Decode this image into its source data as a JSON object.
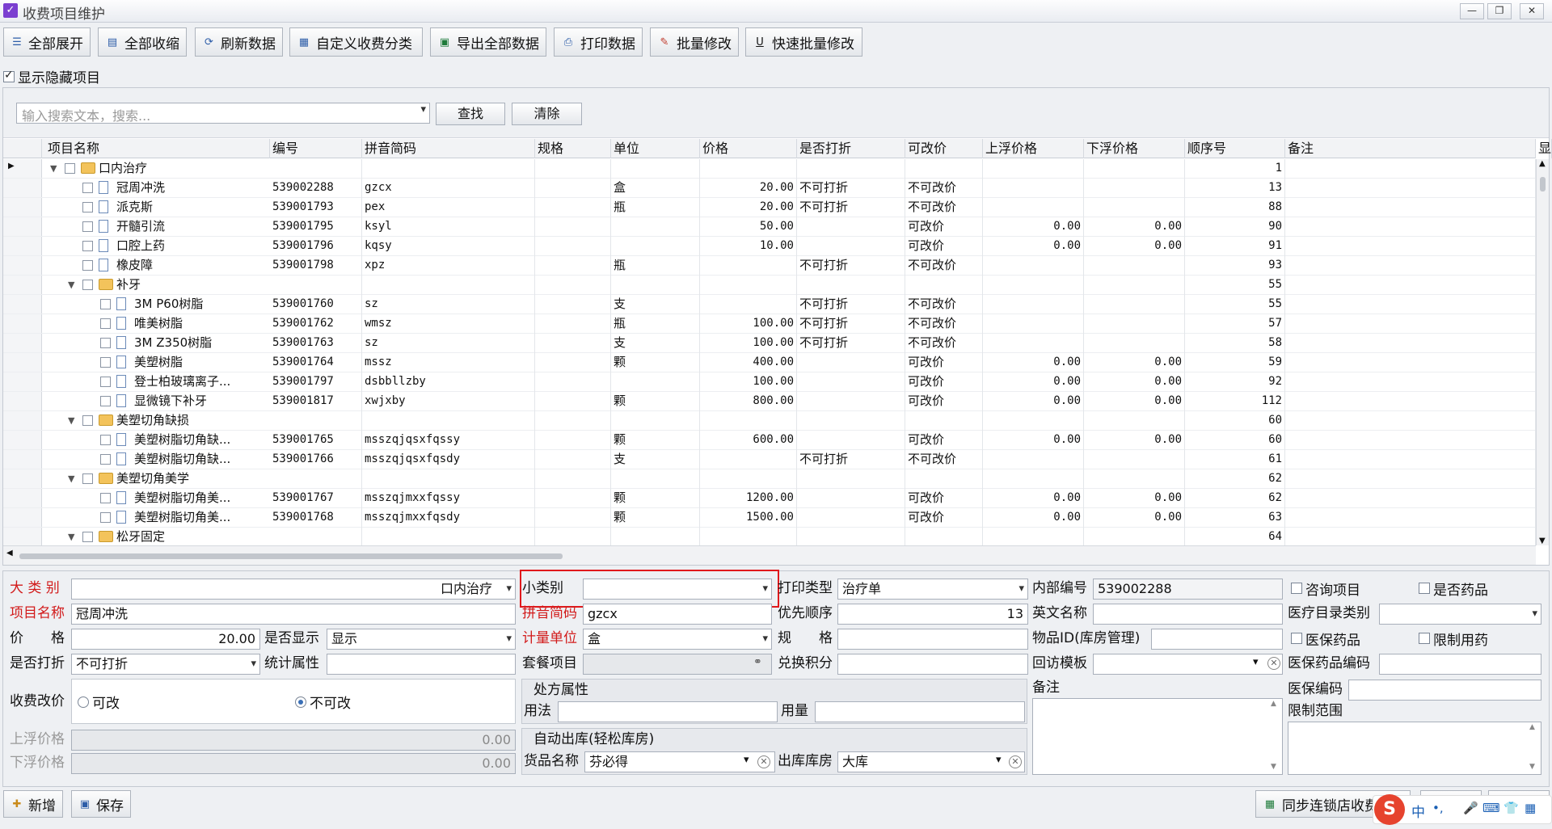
{
  "window": {
    "title": "收费项目维护",
    "controls": {
      "minimize": "—",
      "restore": "❐",
      "close": "✕"
    }
  },
  "toolbar": {
    "buttons": [
      {
        "label": "全部展开",
        "icon": "expand-list-icon"
      },
      {
        "label": "全部收缩",
        "icon": "collapse-list-icon"
      },
      {
        "label": "刷新数据",
        "icon": "refresh-icon"
      },
      {
        "label": "自定义收费分类",
        "icon": "category-edit-icon"
      },
      {
        "label": "导出全部数据",
        "icon": "excel-export-icon"
      },
      {
        "label": "打印数据",
        "icon": "printer-icon"
      },
      {
        "label": "批量修改",
        "icon": "batch-edit-icon"
      },
      {
        "label": "快速批量修改",
        "icon": "underline-u-icon"
      }
    ],
    "show_hidden_label": "显示隐藏项目",
    "show_hidden_checked": true
  },
  "search": {
    "placeholder": "输入搜索文本，搜索...",
    "find_label": "查找",
    "clear_label": "清除"
  },
  "grid": {
    "columns": [
      "项目名称",
      "编号",
      "拼音简码",
      "规格",
      "单位",
      "价格",
      "是否打折",
      "可改价",
      "上浮价格",
      "下浮价格",
      "顺序号",
      "备注",
      "显"
    ],
    "rows": [
      {
        "name": "口内治疗",
        "code": "",
        "py": "",
        "spec": "",
        "unit": "",
        "price": "",
        "discount": "",
        "editable": "",
        "up": "",
        "down": "",
        "order": "1",
        "level": 0,
        "type": "folder",
        "open": true
      },
      {
        "name": "冠周冲洗",
        "code": "539002288",
        "py": "gzcx",
        "spec": "",
        "unit": "盒",
        "price": "20.00",
        "discount": "不可打折",
        "editable": "不可改价",
        "up": "",
        "down": "",
        "order": "13",
        "level": 1,
        "type": "item"
      },
      {
        "name": "派克斯",
        "code": "539001793",
        "py": "pex",
        "spec": "",
        "unit": "瓶",
        "price": "20.00",
        "discount": "不可打折",
        "editable": "不可改价",
        "up": "",
        "down": "",
        "order": "88",
        "level": 1,
        "type": "item"
      },
      {
        "name": "开髓引流",
        "code": "539001795",
        "py": "ksyl",
        "spec": "",
        "unit": "",
        "price": "50.00",
        "discount": "",
        "editable": "可改价",
        "up": "0.00",
        "down": "0.00",
        "order": "90",
        "level": 1,
        "type": "item"
      },
      {
        "name": "口腔上药",
        "code": "539001796",
        "py": "kqsy",
        "spec": "",
        "unit": "",
        "price": "10.00",
        "discount": "",
        "editable": "可改价",
        "up": "0.00",
        "down": "0.00",
        "order": "91",
        "level": 1,
        "type": "item"
      },
      {
        "name": "橡皮障",
        "code": "539001798",
        "py": "xpz",
        "spec": "",
        "unit": "瓶",
        "price": "",
        "discount": "不可打折",
        "editable": "不可改价",
        "up": "",
        "down": "",
        "order": "93",
        "level": 1,
        "type": "item"
      },
      {
        "name": "补牙",
        "code": "",
        "py": "",
        "spec": "",
        "unit": "",
        "price": "",
        "discount": "",
        "editable": "",
        "up": "",
        "down": "",
        "order": "55",
        "level": 1,
        "type": "folder",
        "open": true
      },
      {
        "name": "3M P60树脂",
        "code": "539001760",
        "py": "sz",
        "spec": "",
        "unit": "支",
        "price": "",
        "discount": "不可打折",
        "editable": "不可改价",
        "up": "",
        "down": "",
        "order": "55",
        "level": 2,
        "type": "item"
      },
      {
        "name": "唯美树脂",
        "code": "539001762",
        "py": "wmsz",
        "spec": "",
        "unit": "瓶",
        "price": "100.00",
        "discount": "不可打折",
        "editable": "不可改价",
        "up": "",
        "down": "",
        "order": "57",
        "level": 2,
        "type": "item"
      },
      {
        "name": "3M Z350树脂",
        "code": "539001763",
        "py": "sz",
        "spec": "",
        "unit": "支",
        "price": "100.00",
        "discount": "不可打折",
        "editable": "不可改价",
        "up": "",
        "down": "",
        "order": "58",
        "level": 2,
        "type": "item"
      },
      {
        "name": "美塑树脂",
        "code": "539001764",
        "py": "mssz",
        "spec": "",
        "unit": "颗",
        "price": "400.00",
        "discount": "",
        "editable": "可改价",
        "up": "0.00",
        "down": "0.00",
        "order": "59",
        "level": 2,
        "type": "item"
      },
      {
        "name": "登士柏玻璃离子...",
        "code": "539001797",
        "py": "dsbbllzby",
        "spec": "",
        "unit": "",
        "price": "100.00",
        "discount": "",
        "editable": "可改价",
        "up": "0.00",
        "down": "0.00",
        "order": "92",
        "level": 2,
        "type": "item"
      },
      {
        "name": "显微镜下补牙",
        "code": "539001817",
        "py": "xwjxby",
        "spec": "",
        "unit": "颗",
        "price": "800.00",
        "discount": "",
        "editable": "可改价",
        "up": "0.00",
        "down": "0.00",
        "order": "112",
        "level": 2,
        "type": "item"
      },
      {
        "name": "美塑切角缺损",
        "code": "",
        "py": "",
        "spec": "",
        "unit": "",
        "price": "",
        "discount": "",
        "editable": "",
        "up": "",
        "down": "",
        "order": "60",
        "level": 1,
        "type": "folder",
        "open": true
      },
      {
        "name": "美塑树脂切角缺...",
        "code": "539001765",
        "py": "msszqjqsxfqssy",
        "spec": "",
        "unit": "颗",
        "price": "600.00",
        "discount": "",
        "editable": "可改价",
        "up": "0.00",
        "down": "0.00",
        "order": "60",
        "level": 2,
        "type": "item"
      },
      {
        "name": "美塑树脂切角缺...",
        "code": "539001766",
        "py": "msszqjqsxfqsdy",
        "spec": "",
        "unit": "支",
        "price": "",
        "discount": "不可打折",
        "editable": "不可改价",
        "up": "",
        "down": "",
        "order": "61",
        "level": 2,
        "type": "item"
      },
      {
        "name": "美塑切角美学",
        "code": "",
        "py": "",
        "spec": "",
        "unit": "",
        "price": "",
        "discount": "",
        "editable": "",
        "up": "",
        "down": "",
        "order": "62",
        "level": 1,
        "type": "folder",
        "open": true
      },
      {
        "name": "美塑树脂切角美...",
        "code": "539001767",
        "py": "msszqjmxxfqssy",
        "spec": "",
        "unit": "颗",
        "price": "1200.00",
        "discount": "",
        "editable": "可改价",
        "up": "0.00",
        "down": "0.00",
        "order": "62",
        "level": 2,
        "type": "item"
      },
      {
        "name": "美塑树脂切角美...",
        "code": "539001768",
        "py": "msszqjmxxfqsdy",
        "spec": "",
        "unit": "颗",
        "price": "1500.00",
        "discount": "",
        "editable": "可改价",
        "up": "0.00",
        "down": "0.00",
        "order": "63",
        "level": 2,
        "type": "item"
      },
      {
        "name": "松牙固定",
        "code": "",
        "py": "",
        "spec": "",
        "unit": "",
        "price": "",
        "discount": "",
        "editable": "",
        "up": "",
        "down": "",
        "order": "64",
        "level": 1,
        "type": "folder",
        "open": true
      }
    ]
  },
  "form": {
    "category_label": "大 类 别",
    "category_value": "口内治疗",
    "subcategory_label": "小类别",
    "subcategory_value": "",
    "print_type_label": "打印类型",
    "print_type_value": "治疗单",
    "internal_code_label": "内部编号",
    "internal_code_value": "539002288",
    "consult_label": "咨询项目",
    "is_drug_label": "是否药品",
    "name_label": "项目名称",
    "name_value": "冠周冲洗",
    "pinyin_label": "拼音简码",
    "pinyin_value": "gzcx",
    "priority_label": "优先顺序",
    "priority_value": "13",
    "english_label": "英文名称",
    "english_value": "",
    "med_catalog_label": "医疗目录类别",
    "med_catalog_value": "",
    "price_label": "价　　格",
    "price_value": "20.00",
    "show_label": "是否显示",
    "show_value": "显示",
    "unit_label": "计量单位",
    "unit_value": "盒",
    "spec_label": "规　　格",
    "spec_value": "",
    "item_id_label": "物品ID(库房管理)",
    "item_id_value": "",
    "insurance_drug_label": "医保药品",
    "restricted_drug_label": "限制用药",
    "discount_label": "是否打折",
    "discount_value": "不可打折",
    "stat_label": "统计属性",
    "stat_value": "",
    "package_label": "套餐项目",
    "package_value": "",
    "points_label": "兑换积分",
    "points_value": "",
    "followup_label": "回访模板",
    "followup_value": "",
    "insurance_code_label": "医保药品编码",
    "insurance_code_value": "",
    "price_change_label": "收费改价",
    "can_change_label": "可改",
    "cannot_change_label": "不可改",
    "rx_group_label": "处方属性",
    "usage_label": "用法",
    "usage_value": "",
    "dosage_label": "用量",
    "dosage_value": "",
    "remark_label": "备注",
    "remark_value": "",
    "ins_code2_label": "医保编码",
    "ins_code2_value": "",
    "limit_label": "限制范围",
    "limit_value": "",
    "up_price_label": "上浮价格",
    "up_price_value": "0.00",
    "down_price_label": "下浮价格",
    "down_price_value": "0.00",
    "auto_out_label": "自动出库(轻松库房)",
    "goods_label": "货品名称",
    "goods_value": "芬必得",
    "store_label": "出库库房",
    "store_value": "大库"
  },
  "bottom": {
    "add_label": "新增",
    "save_label": "保存",
    "sync_label": "同步连锁店收费"
  },
  "ime": {
    "lang": "中",
    "punct": "•,"
  },
  "colors": {
    "required_label": "#d21a1a",
    "highlight_box": "#e0191c",
    "folder": "#f3c35b",
    "sogou": "#e6432e"
  }
}
